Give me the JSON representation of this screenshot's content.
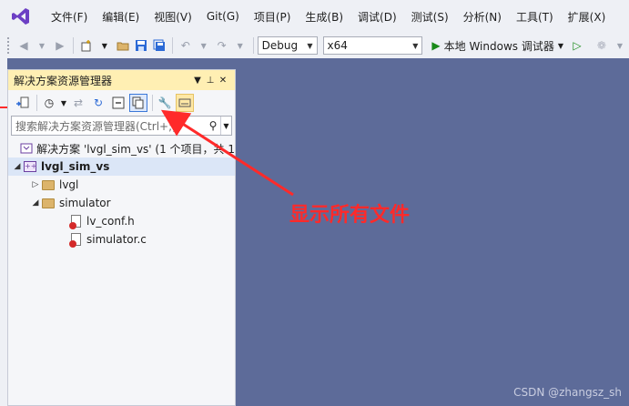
{
  "menubar": {
    "items": [
      "文件(F)",
      "编辑(E)",
      "视图(V)",
      "Git(G)",
      "项目(P)",
      "生成(B)",
      "调试(D)",
      "测试(S)",
      "分析(N)",
      "工具(T)",
      "扩展(X)"
    ]
  },
  "toolbar": {
    "configuration": "Debug",
    "platform": "x64",
    "run_label": "本地 Windows 调试器"
  },
  "panel": {
    "title": "解决方案资源管理器",
    "search_placeholder": "搜索解决方案资源管理器(Ctrl+;)",
    "tree": {
      "solution": "解决方案 'lvgl_sim_vs' (1 个项目，共 1",
      "project": "lvgl_sim_vs",
      "folder_lvgl": "lvgl",
      "folder_simulator": "simulator",
      "file_conf": "lv_conf.h",
      "file_sim": "simulator.c"
    }
  },
  "annotation": {
    "text": "显示所有文件",
    "color": "#ff2a2a"
  },
  "watermark": "CSDN @zhangsz_sh"
}
